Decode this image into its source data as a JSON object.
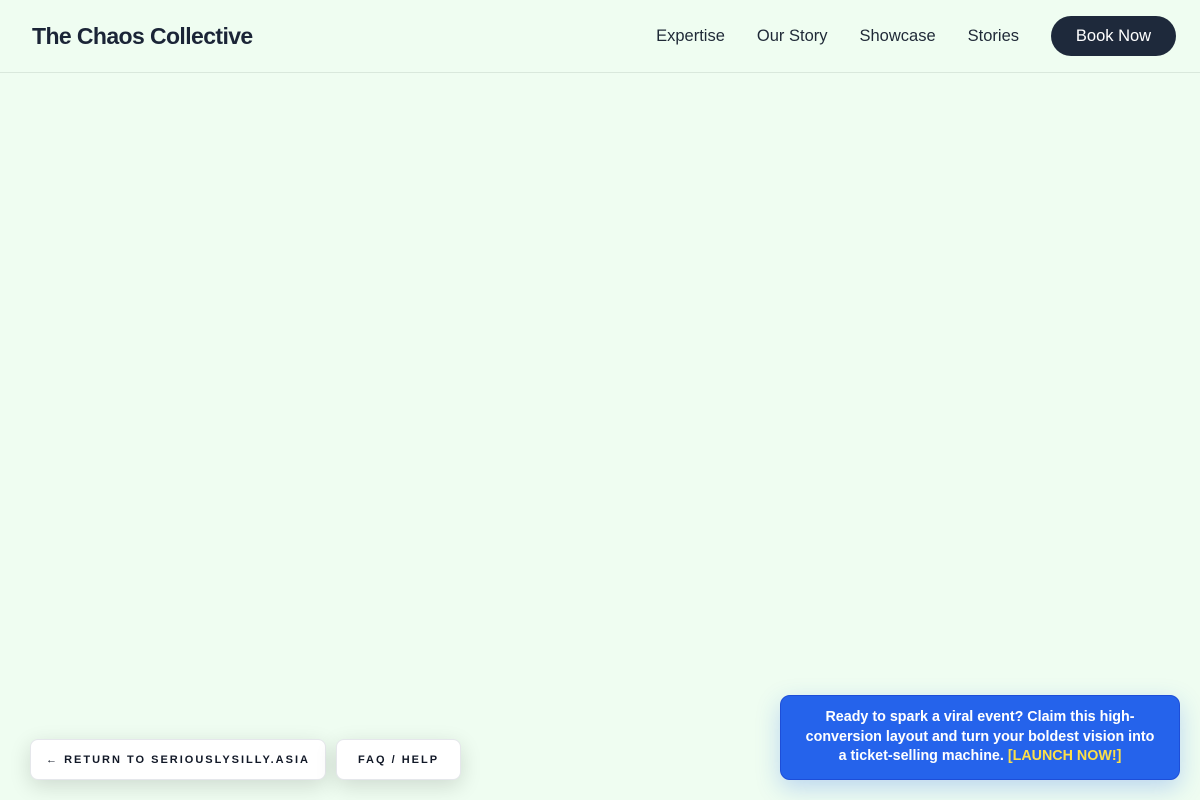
{
  "header": {
    "brand": "The Chaos Collective",
    "nav": [
      {
        "label": "Expertise"
      },
      {
        "label": "Our Story"
      },
      {
        "label": "Showcase"
      },
      {
        "label": "Stories"
      }
    ],
    "cta_label": "Book Now"
  },
  "footer": {
    "return_label": "← RETURN TO SERIOUSLYSILLY.ASIA",
    "faq_label": "FAQ / HELP"
  },
  "banner": {
    "text": "Ready to spark a viral event? Claim this high-conversion layout and turn your boldest vision into a ticket-selling machine.",
    "link_label": "[LAUNCH NOW!]"
  },
  "colors": {
    "background": "#effdf1",
    "primary_dark": "#1e293b",
    "banner_blue": "#2563eb",
    "link_yellow": "#fde047"
  }
}
